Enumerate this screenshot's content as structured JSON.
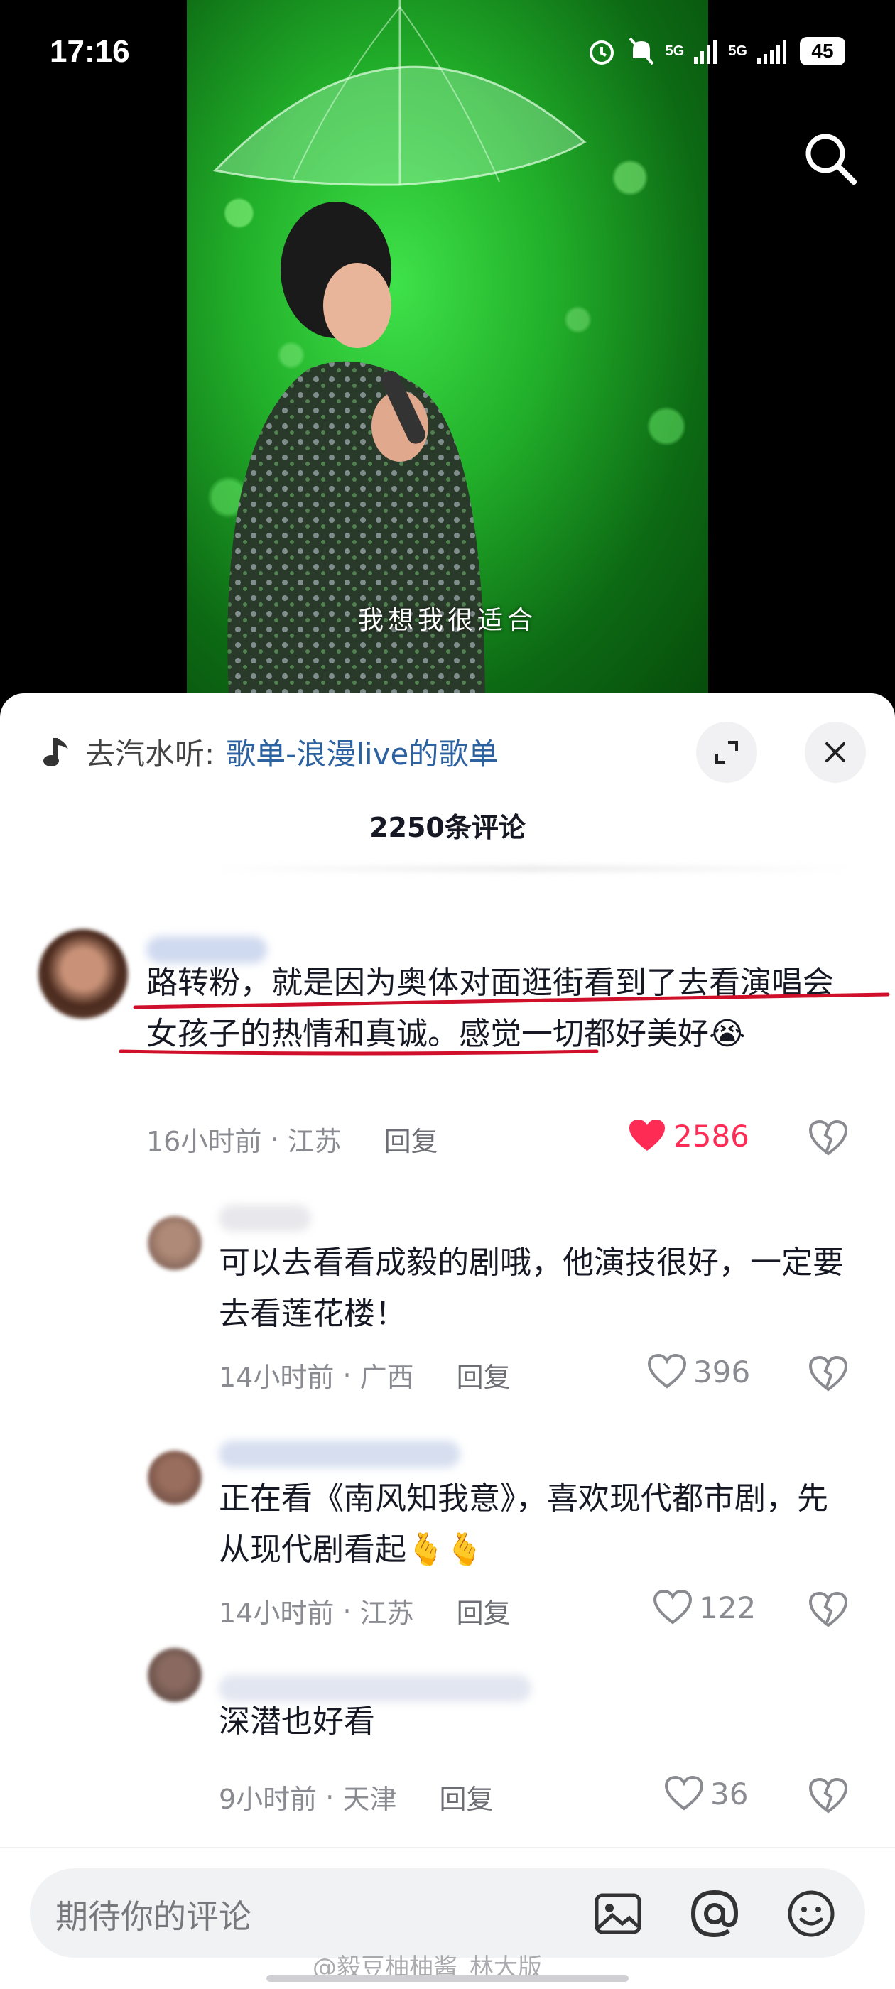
{
  "status_bar": {
    "time": "17:16",
    "network_1": "5G",
    "network_2": "5G",
    "battery": "45"
  },
  "video": {
    "subtitle": "我想我很适合"
  },
  "sheet": {
    "music_prefix": "去汽水听:",
    "music_link": "歌单-浪漫live的歌单",
    "comment_count": "2250条评论"
  },
  "comments": [
    {
      "text": "路转粉，就是因为奥体对面逛街看到了去看演唱会女孩子的热情和真诚。感觉一切都好美好😭",
      "time": "16小时前",
      "location": "江苏",
      "reply": "回复",
      "likes": "2586",
      "liked": true
    },
    {
      "text": "可以去看看成毅的剧哦，他演技很好，一定要去看莲花楼！",
      "time": "14小时前",
      "location": "广西",
      "reply": "回复",
      "likes": "396"
    },
    {
      "text": "正在看《南风知我意》，喜欢现代都市剧，先从现代剧看起🫰🫰",
      "time": "14小时前",
      "location": "江苏",
      "reply": "回复",
      "likes": "122"
    },
    {
      "text": "深潜也好看",
      "time": "9小时前",
      "location": "天津",
      "reply": "回复",
      "likes": "36"
    }
  ],
  "input": {
    "placeholder": "期待你的评论"
  },
  "watermark": "@毅豆柚柚酱_林大版",
  "colors": {
    "like_active": "#fe2c55",
    "link": "#2d62a0",
    "annotation_underline": "#d0102a"
  },
  "icons": [
    "search-icon",
    "music-note-icon",
    "expand-icon",
    "close-icon",
    "heart-icon",
    "dislike-heart-icon",
    "image-icon",
    "at-icon",
    "emoji-icon",
    "alarm-icon",
    "mute-icon"
  ]
}
